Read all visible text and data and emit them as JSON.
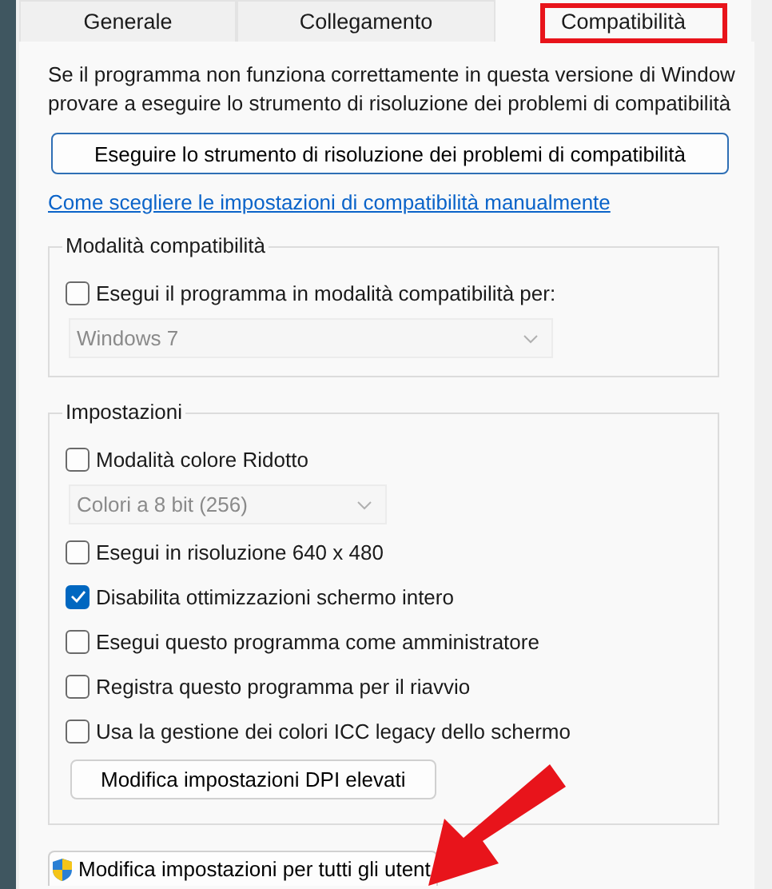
{
  "tabs": [
    {
      "label": "Generale",
      "selected": false
    },
    {
      "label": "Collegamento",
      "selected": false
    },
    {
      "label": "Compatibilità",
      "selected": true
    }
  ],
  "intro_lines": [
    "Se il programma non funziona correttamente in questa versione di Window",
    "provare a eseguire lo strumento di risoluzione dei problemi di compatibilità"
  ],
  "troubleshoot_button": "Eseguire lo strumento di risoluzione dei problemi di compatibilità",
  "manual_link": "Come scegliere le impostazioni di compatibilità manualmente",
  "compat_group": {
    "title": "Modalità compatibilità",
    "items": [
      {
        "kind": "checkbox",
        "label": "Esegui il programma in modalità compatibilità per:",
        "checked": false
      },
      {
        "kind": "select",
        "value": "Windows 7",
        "disabled": true
      }
    ]
  },
  "settings_group": {
    "title": "Impostazioni",
    "items": [
      {
        "kind": "checkbox",
        "label": "Modalità colore Ridotto",
        "checked": false
      },
      {
        "kind": "select",
        "value": "Colori a 8 bit (256)",
        "disabled": true
      },
      {
        "kind": "checkbox",
        "label": "Esegui in risoluzione 640 x 480",
        "checked": false
      },
      {
        "kind": "checkbox",
        "label": "Disabilita ottimizzazioni schermo intero",
        "checked": true
      },
      {
        "kind": "checkbox",
        "label": "Esegui questo programma come amministratore",
        "checked": false
      },
      {
        "kind": "checkbox",
        "label": "Registra questo programma per il riavvio",
        "checked": false
      },
      {
        "kind": "checkbox",
        "label": "Usa la gestione dei colori ICC legacy dello schermo",
        "checked": false
      },
      {
        "kind": "button",
        "label": "Modifica impostazioni DPI elevati"
      }
    ]
  },
  "all_users_button": "Modifica impostazioni per tutti gli utent",
  "annotations": [
    {
      "kind": "frame"
    },
    {
      "kind": "arrow"
    }
  ]
}
